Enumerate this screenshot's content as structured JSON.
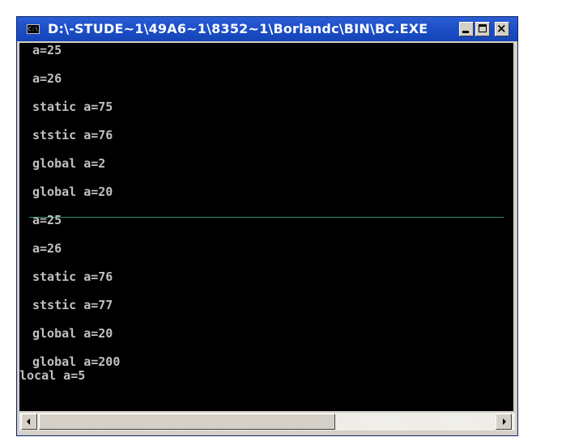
{
  "window": {
    "title": "D:\\-STUDE~1\\49A6~1\\8352~1\\Borlandc\\BIN\\BC.EXE",
    "icon": "console-icon",
    "icon_text": "C:\\",
    "min_label": "",
    "max_label": "",
    "close_label": "×"
  },
  "console": {
    "lines": [
      "a=25",
      "a=26",
      "static a=75",
      "ststic a=76",
      "global a=2",
      "global a=20",
      "a=25",
      "a=26",
      "static a=76",
      "ststic a=77",
      "global a=20",
      "global a=200",
      "local a=5"
    ]
  },
  "colors": {
    "title_bar": "#1d4fc7",
    "console_bg": "#000000",
    "console_text": "#c0c0c0",
    "divider": "#2e8c70"
  }
}
